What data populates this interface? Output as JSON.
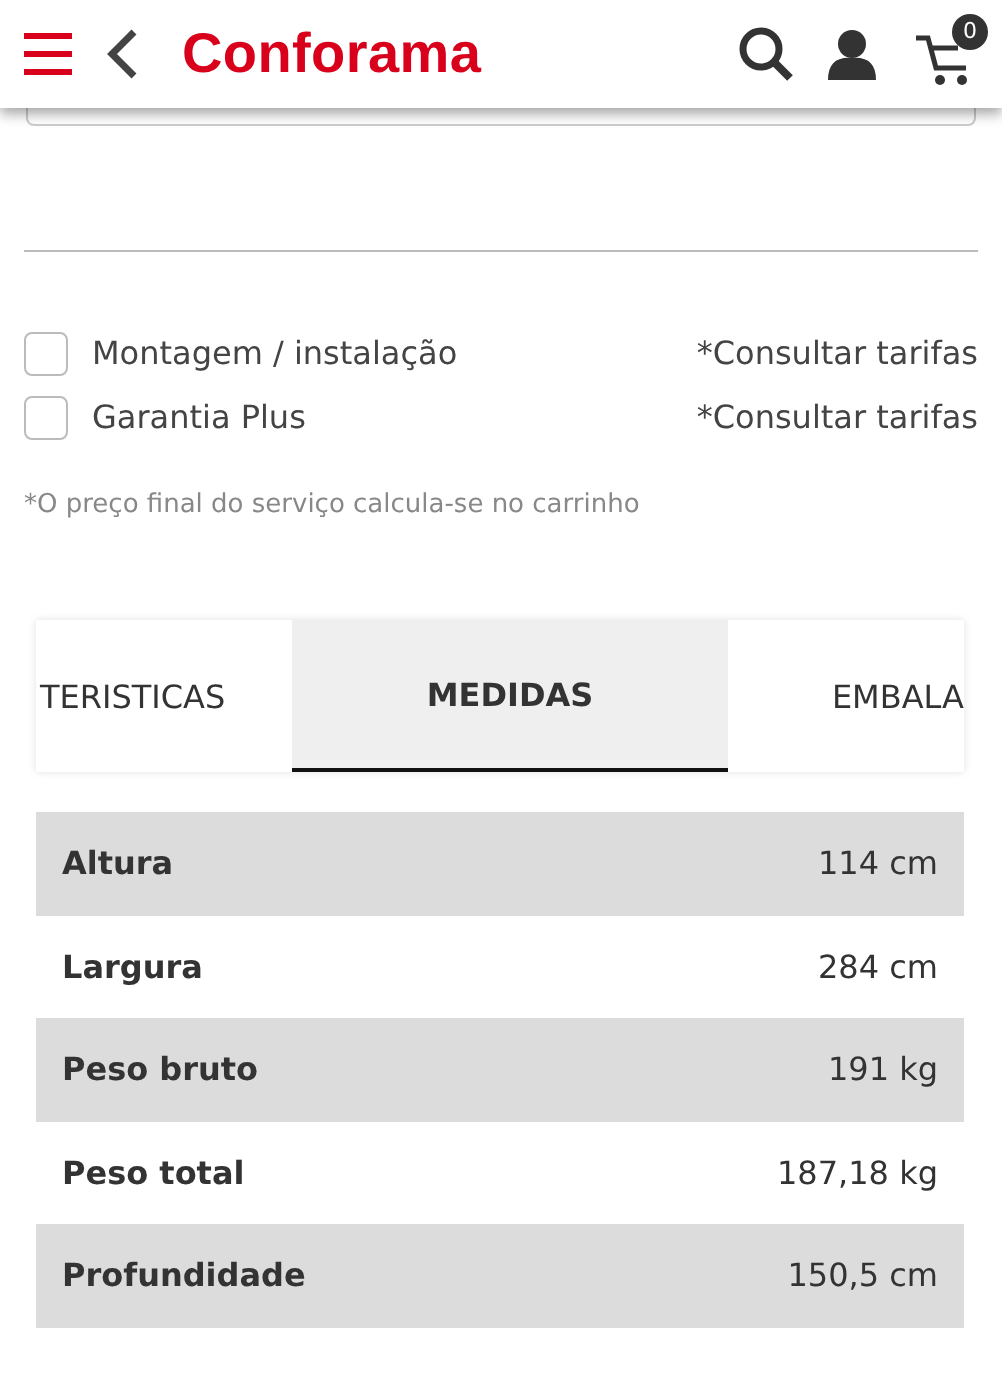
{
  "header": {
    "logo": "Conforama",
    "cart_count": "0"
  },
  "services": [
    {
      "label": "Montagem / instalação",
      "price": "*Consultar tarifas",
      "checked": false
    },
    {
      "label": "Garantia Plus",
      "price": "*Consultar tarifas",
      "checked": false
    }
  ],
  "services_note": "*O preço final do serviço calcula-se no carrinho",
  "tabs": [
    {
      "label": "TERISTICAS",
      "selected": false
    },
    {
      "label": "MEDIDAS",
      "selected": true
    },
    {
      "label": "EMBALA",
      "selected": false
    }
  ],
  "specs": [
    {
      "name": "Altura",
      "value": "114 cm"
    },
    {
      "name": "Largura",
      "value": "284 cm"
    },
    {
      "name": "Peso bruto",
      "value": "191 kg"
    },
    {
      "name": "Peso total",
      "value": "187,18 kg"
    },
    {
      "name": "Profundidade",
      "value": "150,5 cm"
    }
  ]
}
